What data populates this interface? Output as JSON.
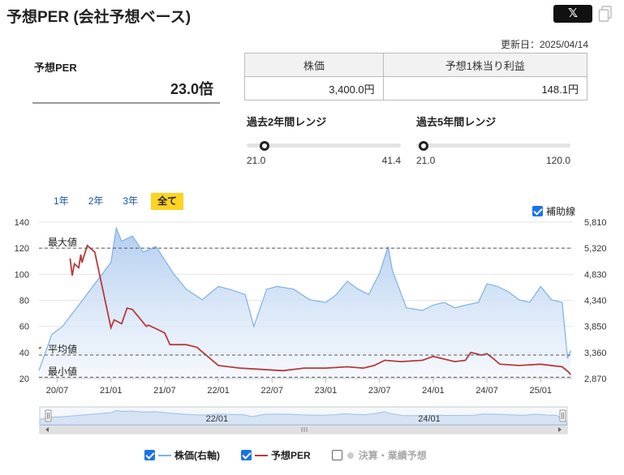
{
  "header": {
    "title": "予想PER (会社予想ベース)",
    "share_x": "𝕏"
  },
  "updated": "更新日：2025/04/14",
  "per": {
    "label": "予想PER",
    "value": "23.0倍"
  },
  "price_table": {
    "headers": [
      "株価",
      "予想1株当り利益"
    ],
    "values": [
      "3,400.0円",
      "148.1円"
    ]
  },
  "range_2y": {
    "label": "過去2年間レンジ",
    "min": "21.0",
    "max": "41.4",
    "current": 23.0
  },
  "range_5y": {
    "label": "過去5年間レンジ",
    "min": "21.0",
    "max": "120.0",
    "current": 23.0
  },
  "period_tabs": [
    {
      "label": "1年",
      "active": false
    },
    {
      "label": "2年",
      "active": false
    },
    {
      "label": "3年",
      "active": false
    },
    {
      "label": "全て",
      "active": true
    }
  ],
  "aux_line": {
    "label": "補助線",
    "checked": true
  },
  "chart_data": {
    "type": "line",
    "left_axis": {
      "ticks": [
        "140",
        "120",
        "100",
        "80",
        "60",
        "40",
        "20"
      ],
      "range": [
        20,
        140
      ]
    },
    "right_axis": {
      "ticks": [
        "5,810",
        "5,320",
        "4,830",
        "4,340",
        "3,850",
        "3,360",
        "2,870"
      ],
      "range": [
        2870,
        5810
      ]
    },
    "x_ticks": [
      "20/07",
      "21/01",
      "21/07",
      "22/01",
      "22/07",
      "23/01",
      "23/07",
      "24/01",
      "24/07",
      "25/01"
    ],
    "ref_lines": [
      {
        "label": "最大値",
        "value": 120
      },
      {
        "label": "平均値",
        "value": 38
      },
      {
        "label": "最小値",
        "value": 21
      }
    ],
    "navigator_ticks": [
      "22/01",
      "24/01"
    ],
    "series": [
      {
        "name": "株価(右軸)",
        "axis": "right",
        "color": "#7cb2e8",
        "x": [
          2020.33,
          2020.45,
          2020.55,
          2020.7,
          2020.85,
          2021.0,
          2021.05,
          2021.1,
          2021.2,
          2021.3,
          2021.42,
          2021.5,
          2021.58,
          2021.7,
          2021.85,
          2022.0,
          2022.1,
          2022.25,
          2022.33,
          2022.45,
          2022.55,
          2022.7,
          2022.85,
          2023.0,
          2023.1,
          2023.2,
          2023.3,
          2023.4,
          2023.5,
          2023.58,
          2023.62,
          2023.75,
          2023.9,
          2024.0,
          2024.1,
          2024.2,
          2024.3,
          2024.42,
          2024.5,
          2024.6,
          2024.7,
          2024.8,
          2024.9,
          2025.0,
          2025.1,
          2025.2,
          2025.25,
          2025.28
        ],
        "y": [
          3020,
          3700,
          3850,
          4250,
          4650,
          5050,
          5700,
          5450,
          5550,
          5250,
          5350,
          5100,
          4850,
          4550,
          4350,
          4600,
          4550,
          4450,
          3850,
          4550,
          4600,
          4550,
          4350,
          4300,
          4450,
          4700,
          4550,
          4450,
          4850,
          5350,
          4900,
          4200,
          4150,
          4250,
          4300,
          4200,
          4250,
          4300,
          4650,
          4600,
          4500,
          4350,
          4300,
          4600,
          4350,
          4300,
          3250,
          3400
        ]
      },
      {
        "name": "予想PER",
        "axis": "left",
        "color": "#b83a3a",
        "x": [
          2020.33,
          2020.35,
          2020.6,
          2020.62,
          2020.64,
          2020.66,
          2020.7,
          2020.72,
          2020.73,
          2020.78,
          2020.85,
          2021.0,
          2021.03,
          2021.1,
          2021.15,
          2021.2,
          2021.33,
          2021.35,
          2021.5,
          2021.55,
          2021.6,
          2021.7,
          2021.8,
          2022.0,
          2022.2,
          2022.4,
          2022.6,
          2022.8,
          2023.0,
          2023.2,
          2023.35,
          2023.45,
          2023.5,
          2023.55,
          2023.7,
          2023.9,
          2024.0,
          2024.2,
          2024.3,
          2024.35,
          2024.45,
          2024.5,
          2024.55,
          2024.62,
          2024.8,
          2025.0,
          2025.2,
          2025.26,
          2025.28
        ],
        "y": [
          43,
          44,
          null,
          112,
          99,
          108,
          105,
          115,
          109,
          122,
          117,
          59,
          65,
          62,
          74,
          73,
          60,
          61,
          55,
          46,
          46,
          46,
          44,
          30,
          28,
          27,
          26,
          28,
          28,
          29,
          28,
          30,
          32,
          34,
          33,
          34,
          37,
          33,
          34,
          40,
          38,
          39,
          36,
          31,
          30,
          31,
          29,
          25,
          23
        ]
      }
    ]
  },
  "legend": {
    "price": "株価(右軸)",
    "per": "予想PER",
    "forecast": "決算・業績予想"
  }
}
